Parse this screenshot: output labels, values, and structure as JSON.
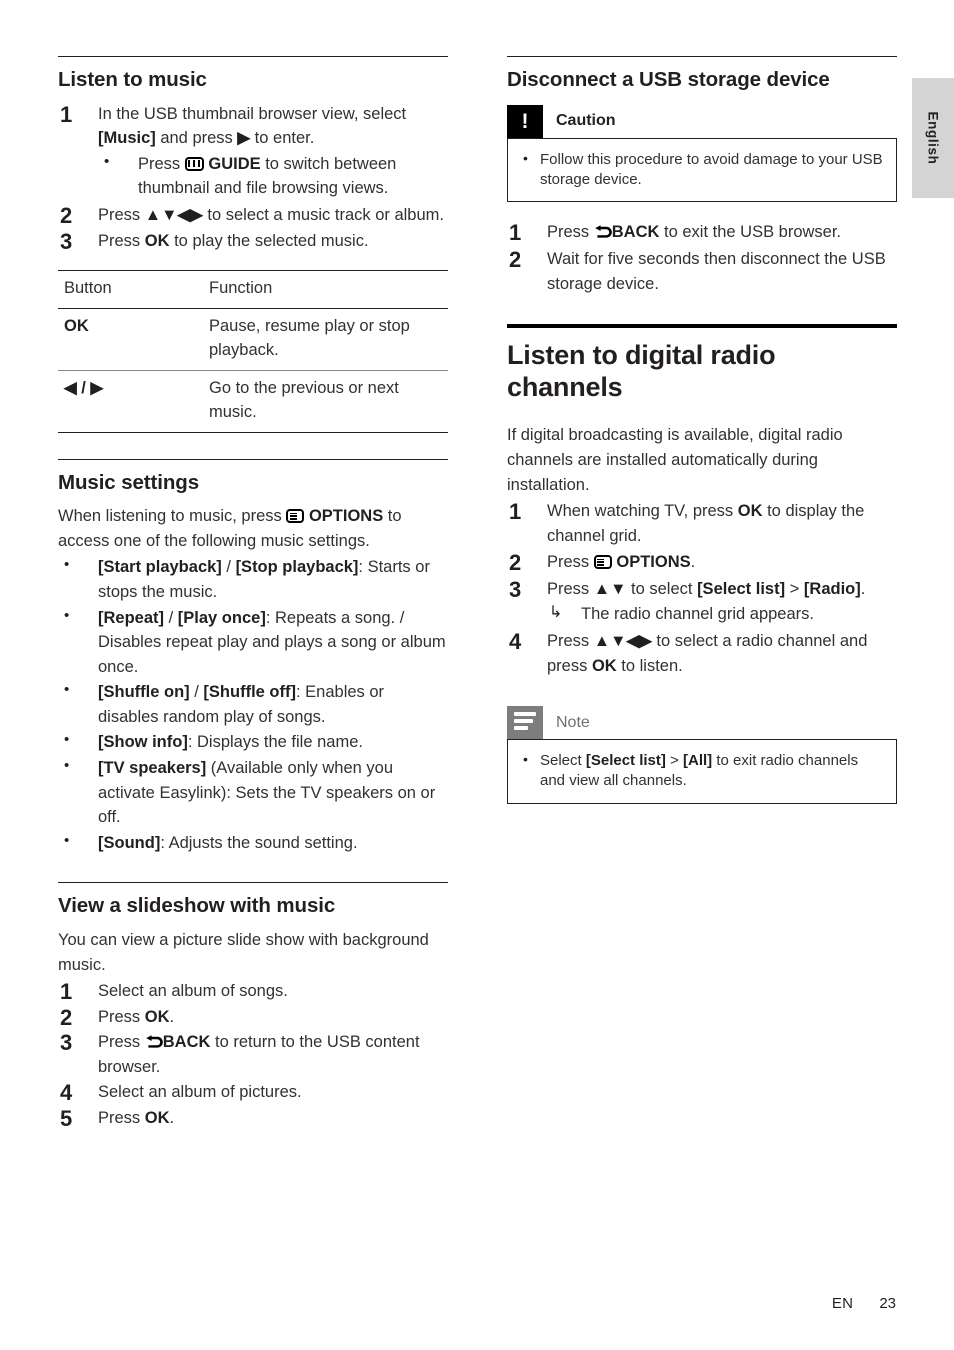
{
  "page": {
    "language_tab": "English",
    "footer_lang": "EN",
    "footer_page": "23"
  },
  "left_column": {
    "section1": {
      "heading": "Listen to music",
      "steps": [
        {
          "num": "1",
          "text_before": "In the USB thumbnail browser view, select ",
          "bold1": "[Music]",
          "text_mid": " and press ",
          "arrow": "▶",
          "text_after": " to enter.",
          "sub_bullet_before": "Press ",
          "sub_bullet_icon": "guide-icon",
          "sub_bullet_bold": "GUIDE",
          "sub_bullet_after": " to switch between thumbnail and file browsing views."
        },
        {
          "num": "2",
          "text_before": "Press ",
          "arrows": "▲▼◀▶",
          "text_after": " to select a music track or album."
        },
        {
          "num": "3",
          "text_before": "Press ",
          "bold1": "OK",
          "text_after": " to play the selected music."
        }
      ],
      "table": {
        "headers": [
          "Button",
          "Function"
        ],
        "rows": [
          {
            "button": "OK",
            "function": "Pause, resume play or stop playback."
          },
          {
            "button": "◀ / ▶",
            "function": "Go to the previous or next music."
          }
        ]
      }
    },
    "section2": {
      "heading": "Music settings",
      "intro_before": "When listening to music, press ",
      "intro_icon": "options-icon",
      "intro_bold": "OPTIONS",
      "intro_after": " to access one of the following music settings.",
      "bullets": [
        {
          "bold1": "[Start playback]",
          "sep": " / ",
          "bold2": "[Stop playback]",
          "text": ": Starts or stops the music."
        },
        {
          "bold1": "[Repeat]",
          "sep": " / ",
          "bold2": "[Play once]",
          "text": ": Repeats a song. / Disables repeat play and plays a song or album once."
        },
        {
          "bold1": "[Shuffle on]",
          "sep": " / ",
          "bold2": "[Shuffle off]",
          "text": ": Enables or disables random play of songs."
        },
        {
          "bold1": "[Show info]",
          "sep": "",
          "bold2": "",
          "text": ": Displays the file name."
        },
        {
          "bold1": "[TV speakers]",
          "sep": "",
          "bold2": "",
          "text": " (Available only when you activate Easylink): Sets the TV speakers on or off."
        },
        {
          "bold1": "[Sound]",
          "sep": "",
          "bold2": "",
          "text": ": Adjusts the sound setting."
        }
      ]
    },
    "section3": {
      "heading": "View a slideshow with music",
      "intro": "You can view a picture slide show with background music.",
      "steps": [
        {
          "num": "1",
          "text_before": "Select an album of songs.",
          "bold1": "",
          "text_after": ""
        },
        {
          "num": "2",
          "text_before": "Press ",
          "bold1": "OK",
          "text_after": "."
        },
        {
          "num": "3",
          "text_before": "Press ",
          "bold1": "BACK",
          "text_after": " to return to the USB content browser.",
          "icon": "back-icon"
        },
        {
          "num": "4",
          "text_before": "Select an album of pictures.",
          "bold1": "",
          "text_after": ""
        },
        {
          "num": "5",
          "text_before": "Press ",
          "bold1": "OK",
          "text_after": "."
        }
      ]
    }
  },
  "right_column": {
    "section1": {
      "heading": "Disconnect a USB storage device",
      "caution": {
        "title": "Caution",
        "badge_glyph": "!",
        "bullets": [
          "Follow this procedure to avoid damage to your USB storage device."
        ]
      },
      "steps": [
        {
          "num": "1",
          "text_before": "Press ",
          "bold1": "BACK",
          "text_after": " to exit the USB browser.",
          "icon": "back-icon"
        },
        {
          "num": "2",
          "text_before": "Wait for five seconds then disconnect the USB storage device.",
          "bold1": "",
          "text_after": ""
        }
      ]
    },
    "section2": {
      "heading": "Listen to digital radio channels",
      "intro": "If digital broadcasting is available, digital radio channels are installed automatically during installation.",
      "steps": [
        {
          "num": "1",
          "text_before": "When watching TV, press ",
          "bold1": "OK",
          "text_after": " to display the channel grid."
        },
        {
          "num": "2",
          "text_before": "Press ",
          "icon": "options-icon",
          "bold1": "OPTIONS",
          "text_after": "."
        },
        {
          "num": "3",
          "text_before": "Press ",
          "arrows": "▲▼",
          "text_mid": " to select ",
          "bold1": "[Select list]",
          "sep": " > ",
          "bold2": "[Radio]",
          "text_after": ".",
          "result": "The radio channel grid appears."
        },
        {
          "num": "4",
          "text_before": "Press ",
          "arrows": "▲▼◀▶",
          "text_mid": " to select a radio channel and press ",
          "bold1": "OK",
          "text_after": " to listen."
        }
      ],
      "note": {
        "title": "Note",
        "bullet_before": "Select ",
        "bullet_bold1": "[Select list]",
        "bullet_sep": " > ",
        "bullet_bold2": "[All]",
        "bullet_after": " to exit radio channels and view all channels."
      }
    }
  }
}
